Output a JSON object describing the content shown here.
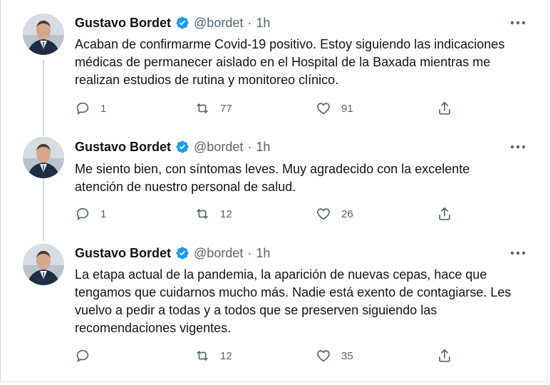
{
  "tweets": [
    {
      "author_name": "Gustavo Bordet",
      "handle": "@bordet",
      "time": "1h",
      "text": "Acaban de confirmarme Covid-19 positivo. Estoy siguiendo las indicaciones\nmédicas de permanecer aislado en el Hospital de la Baxada mientras me\nrealizan estudios de rutina y monitoreo clínico.",
      "replies": "1",
      "retweets": "77",
      "likes": "91"
    },
    {
      "author_name": "Gustavo Bordet",
      "handle": "@bordet",
      "time": "1h",
      "text": "Me siento bien, con síntomas leves. Muy agradecido con la excelente\natención de nuestro personal de salud.",
      "replies": "1",
      "retweets": "12",
      "likes": "26"
    },
    {
      "author_name": "Gustavo Bordet",
      "handle": "@bordet",
      "time": "1h",
      "text": "La etapa actual de la pandemia, la aparición de nuevas cepas, hace que\ntengamos que cuidarnos mucho más. Nadie está exento de contagiarse. Les\nvuelvo a pedir a todas y a todos que se preserven siguiendo las\nrecomendaciones vigentes.",
      "replies": "",
      "retweets": "12",
      "likes": "35"
    }
  ],
  "separator": "·",
  "icons": {
    "verified": "verified-badge-icon",
    "more": "more-options-icon",
    "reply": "reply-icon",
    "retweet": "retweet-icon",
    "like": "heart-icon",
    "share": "share-icon"
  },
  "colors": {
    "verified": "#1d9bf0",
    "muted": "#536471",
    "text": "#0f1419",
    "thread_line": "#cfd9de"
  }
}
